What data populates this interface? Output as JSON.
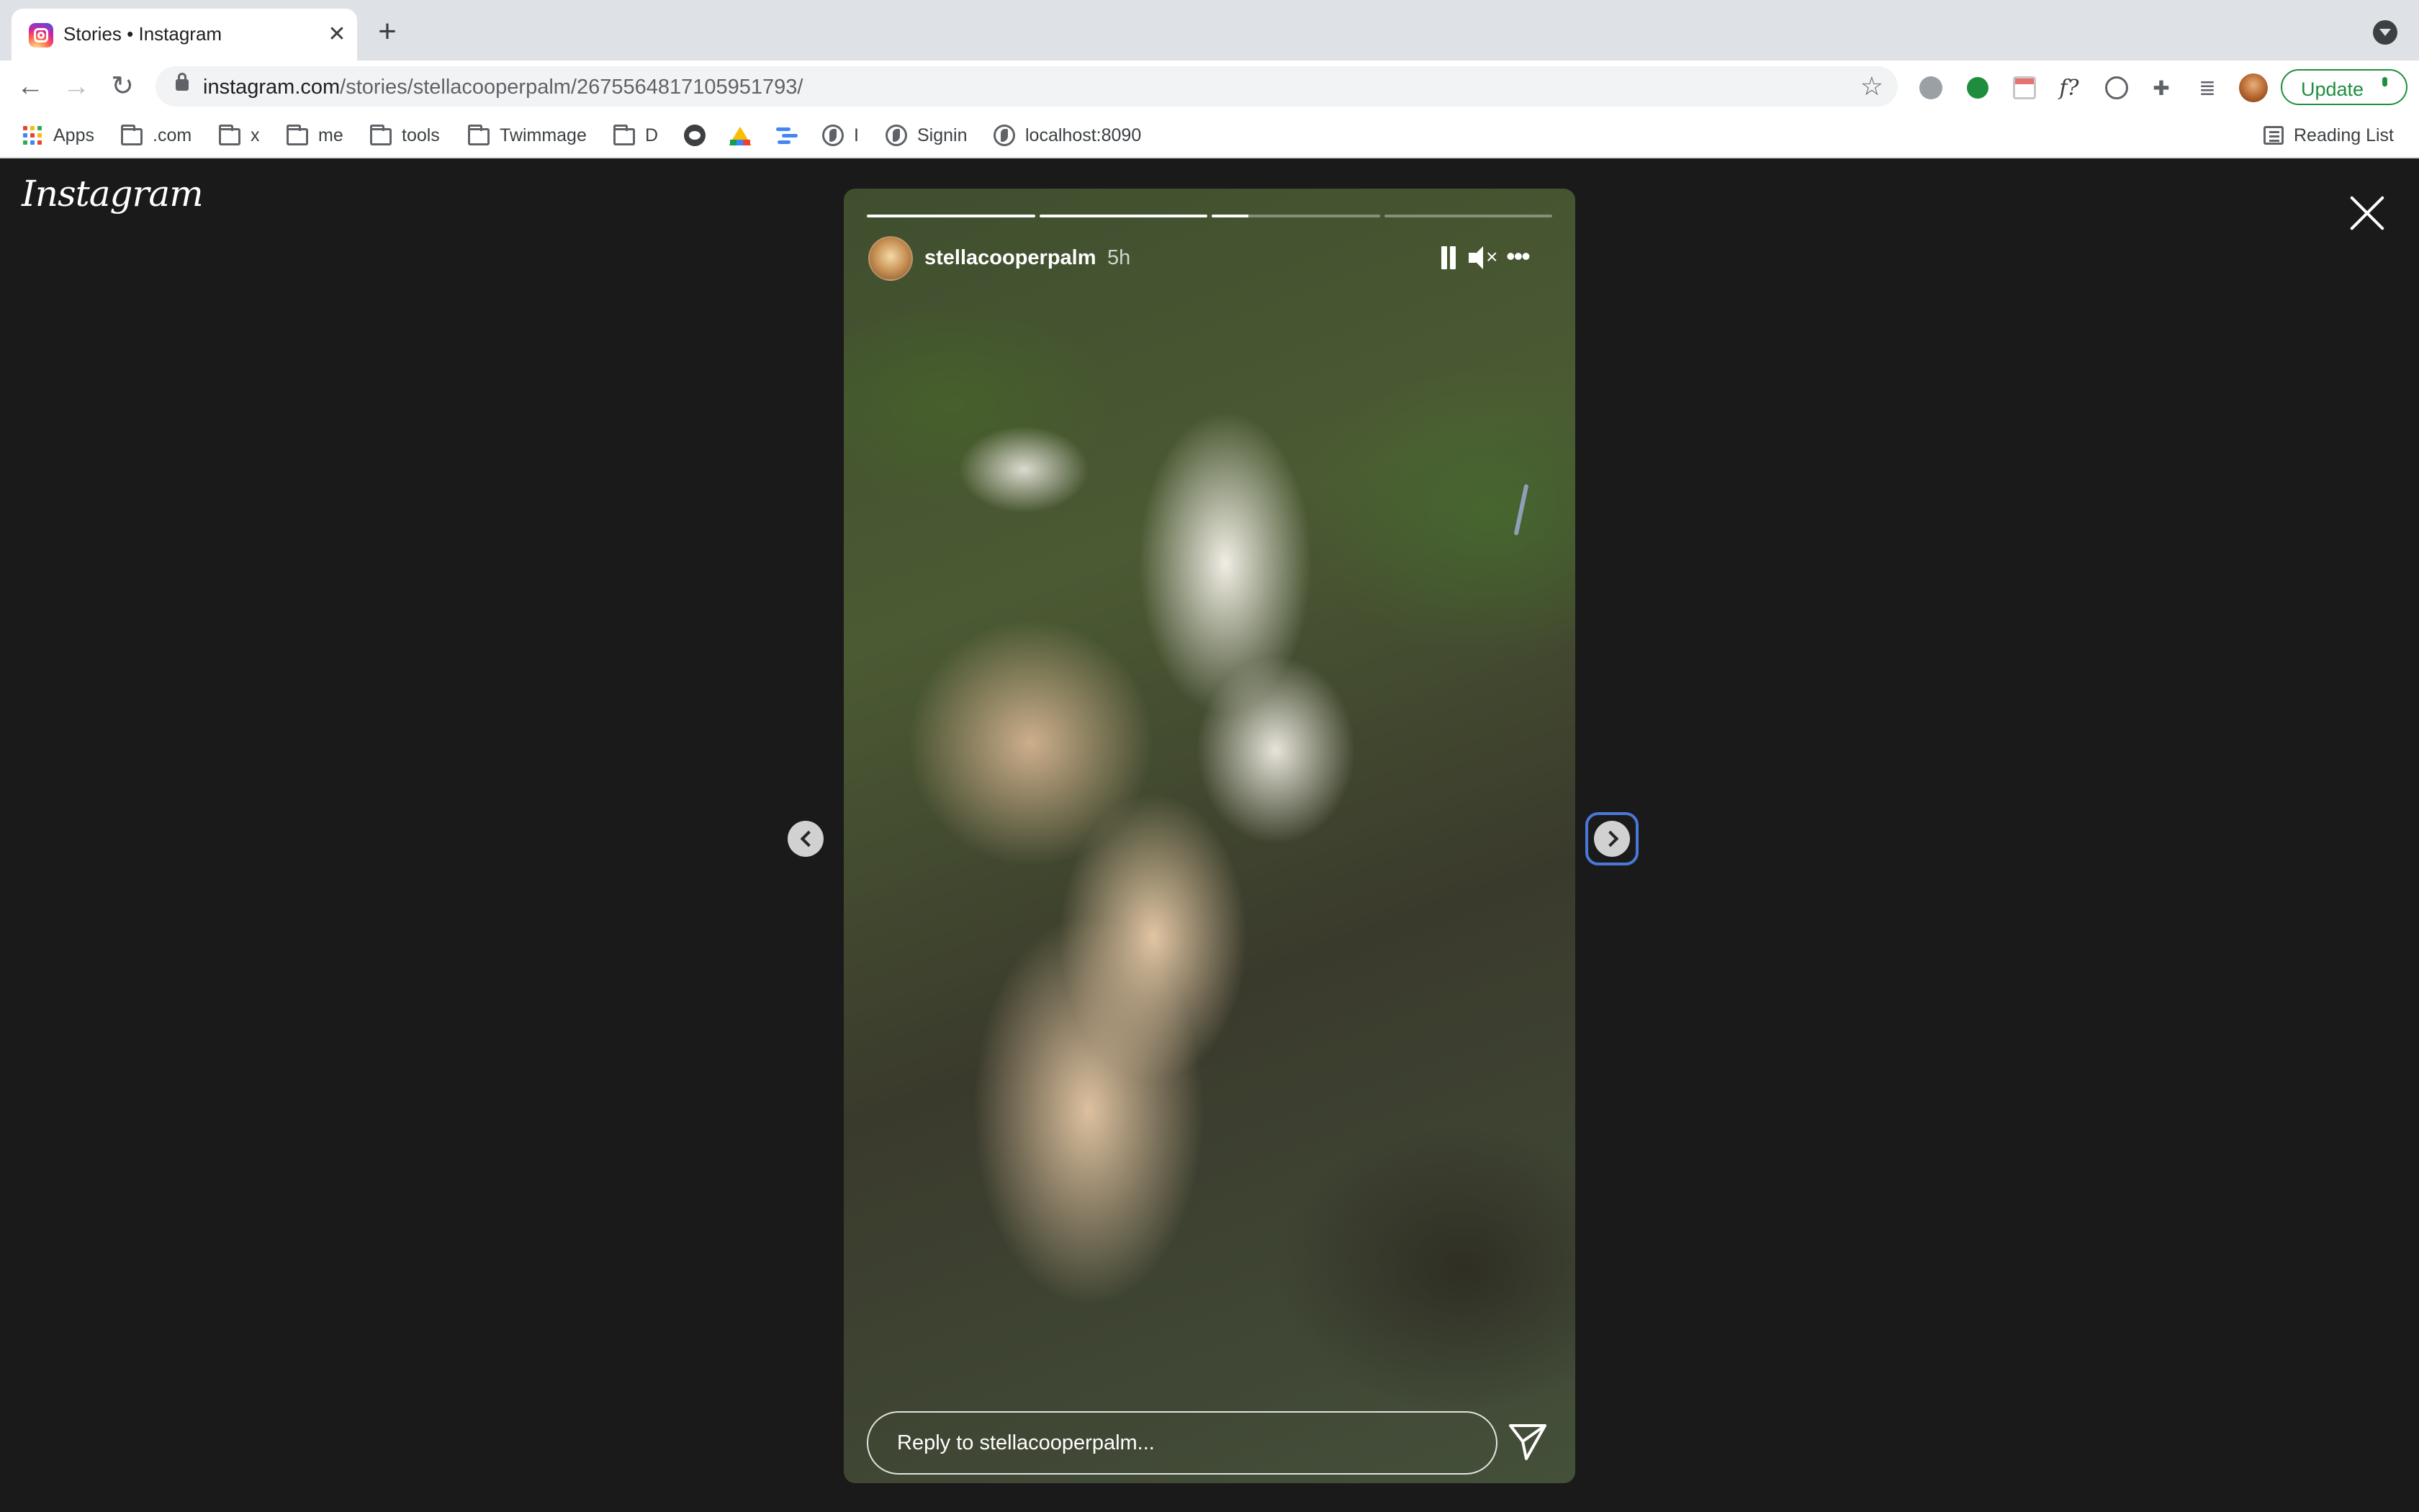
{
  "browser": {
    "tab_title": "Stories • Instagram",
    "tab_close": "✕",
    "new_tab": "+",
    "url_host": "instagram.com",
    "url_path": "/stories/stellacooperpalm/2675564817105951793/",
    "update_label": "Update",
    "nav": {
      "back": "←",
      "forward": "→",
      "reload": "↻"
    },
    "star": "☆",
    "menu_dots": "⋮"
  },
  "bookmarks": [
    {
      "label": "Apps",
      "icon": "apps-icon"
    },
    {
      "label": ".com",
      "icon": "folder-icon"
    },
    {
      "label": "x",
      "icon": "folder-icon"
    },
    {
      "label": "me",
      "icon": "folder-icon"
    },
    {
      "label": "tools",
      "icon": "folder-icon"
    },
    {
      "label": "Twimmage",
      "icon": "folder-icon"
    },
    {
      "label": "D",
      "icon": "folder-icon"
    },
    {
      "label": "",
      "icon": "octocat-icon"
    },
    {
      "label": "",
      "icon": "drive-icon"
    },
    {
      "label": "",
      "icon": "stack-icon"
    },
    {
      "label": "I",
      "icon": "globe-icon"
    },
    {
      "label": "Signin",
      "icon": "globe-icon"
    },
    {
      "label": "localhost:8090",
      "icon": "globe-icon"
    }
  ],
  "reading_list": "Reading List",
  "instagram": {
    "logo": "Instagram",
    "story": {
      "username": "stellacooperpalm",
      "time_ago": "5h",
      "progress": [
        1,
        1,
        0.22,
        0
      ],
      "reply_placeholder": "Reply to stellacooperpalm..."
    },
    "more": "•••"
  },
  "colors": {
    "instagram_bg": "#1a1a1a",
    "update_green": "#1e8e3e",
    "focus_outline": "#4a78d8"
  }
}
